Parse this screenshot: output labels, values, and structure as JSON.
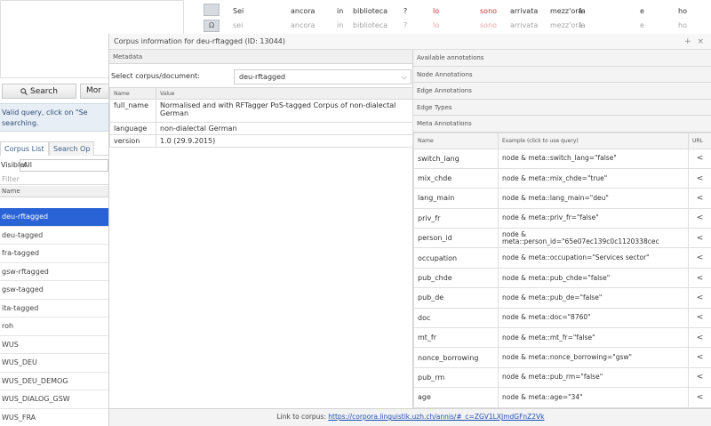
{
  "kwic": {
    "rows": [
      [
        "Sei",
        "ancora",
        "in",
        "biblioteca",
        "?",
        "lo",
        "sono",
        "arrivata",
        "mezz'ora",
        "fa",
        "e",
        "ho"
      ],
      [
        "sei",
        "ancora",
        "in",
        "biblioteca",
        "?",
        "lo",
        "sono",
        "arrivata",
        "mezz'ora",
        "fa",
        "e",
        "ho"
      ]
    ],
    "icon_labels": [
      "",
      "Ω"
    ]
  },
  "left": {
    "search_label": "Search",
    "more_label": "Mor",
    "valid_msg_1": "Valid query, click on \"Se",
    "valid_msg_2": "searching.",
    "tab_corpus_list": "Corpus List",
    "tab_search_options": "Search Op",
    "visible_label": "Visible:",
    "visible_value": "All",
    "filter_placeholder": "Filter",
    "col_name": "Name",
    "corpora": [
      "deu-rftagged",
      "deu-tagged",
      "fra-tagged",
      "gsw-rftagged",
      "gsw-tagged",
      "ita-tagged",
      "roh",
      "WUS",
      "WUS_DEU",
      "WUS_DEU_DEMOG",
      "WUS_DIALOG_GSW",
      "WUS_FRA"
    ],
    "selected_index": 0
  },
  "dialog": {
    "title": "Corpus information for deu-rftagged (ID: 13044)",
    "controls": "+ ×",
    "metadata_header": "Metadata",
    "select_label": "Select corpus/document:",
    "select_value": "deu-rftagged",
    "meta_cols": [
      "Name",
      "Value"
    ],
    "meta_rows": [
      {
        "k": "full_name",
        "v": "Normalised and with RFTagger PoS-tagged Corpus of non-dialectal German"
      },
      {
        "k": "language",
        "v": "non-dialectal German"
      },
      {
        "k": "version",
        "v": "1.0 (29.9.2015)"
      }
    ],
    "available_header": "Available annotations",
    "sections": [
      "Node Annotations",
      "Edge Annotations",
      "Edge Types",
      "Meta Annotations"
    ],
    "ann_cols": [
      "Name",
      "Example (click to use query)",
      "URL"
    ],
    "ann_rows": [
      {
        "name": "switch_lang",
        "ex": "node & meta::switch_lang=\"false\""
      },
      {
        "name": "mix_chde",
        "ex": "node & meta::mix_chde=\"true\""
      },
      {
        "name": "lang_main",
        "ex": "node & meta::lang_main=\"deu\""
      },
      {
        "name": "priv_fr",
        "ex": "node & meta::priv_fr=\"false\""
      },
      {
        "name": "person_id",
        "ex": "node & meta::person_id=\"65e07ec139c0c1120338cec"
      },
      {
        "name": "occupation",
        "ex": "node & meta::occupation=\"Services sector\""
      },
      {
        "name": "pub_chde",
        "ex": "node & meta::pub_chde=\"false\""
      },
      {
        "name": "pub_de",
        "ex": "node & meta::pub_de=\"false\""
      },
      {
        "name": "doc",
        "ex": "node & meta::doc=\"8760\""
      },
      {
        "name": "mt_fr",
        "ex": "node & meta::mt_fr=\"false\""
      },
      {
        "name": "nonce_borrowing",
        "ex": "node & meta::nonce_borrowing=\"gsw\""
      },
      {
        "name": "pub_rm",
        "ex": "node & meta::pub_rm=\"false\""
      },
      {
        "name": "age",
        "ex": "node & meta::age=\"34\""
      }
    ],
    "footer_label": "Link to corpus:",
    "footer_link": "https://corpora.linguistik.uzh.ch/annis/#_c=ZGV1LXJmdGFnZ2Vk"
  }
}
